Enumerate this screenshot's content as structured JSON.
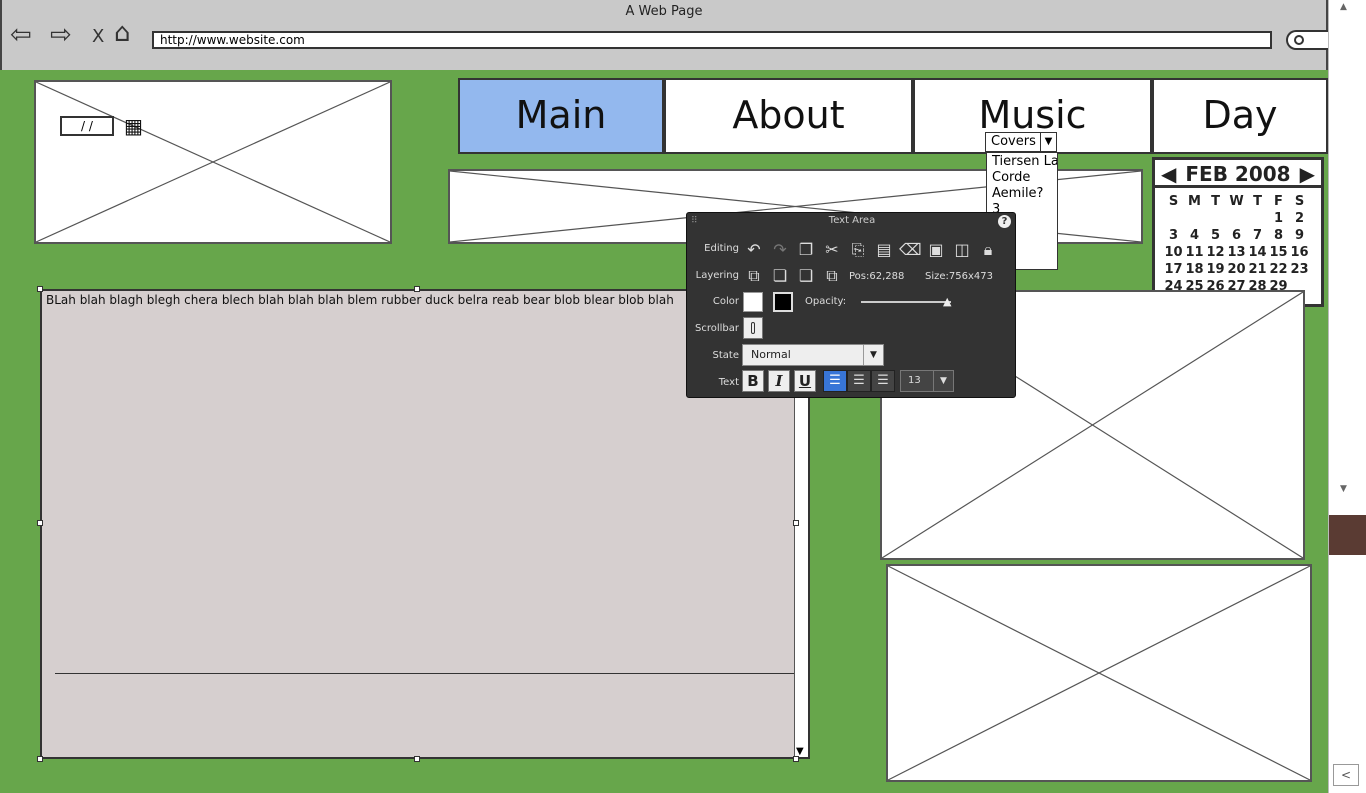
{
  "browser": {
    "title": "A Web Page",
    "url": "http://www.website.com",
    "close_glyph": "X",
    "icons": [
      "back-arrow-icon",
      "forward-arrow-icon",
      "stop-icon",
      "home-icon",
      "search-icon"
    ]
  },
  "date_field": {
    "value": "/ /"
  },
  "nav": {
    "tabs": [
      "Main",
      "About",
      "Music",
      "Day"
    ],
    "active": "Main",
    "active_color": "#93b8ee"
  },
  "music_dropdown": {
    "selected": "Covers",
    "items": [
      "Tiersen La",
      "Corde",
      "Aemile?",
      "3"
    ]
  },
  "calendar": {
    "month": "FEB 2008",
    "weekdays": [
      "S",
      "M",
      "T",
      "W",
      "T",
      "F",
      "S"
    ],
    "weeks": [
      [
        "",
        "",
        "",
        "",
        "",
        "1",
        "2"
      ],
      [
        "3",
        "4",
        "5",
        "6",
        "7",
        "8",
        "9"
      ],
      [
        "10",
        "11",
        "12",
        "13",
        "14",
        "15",
        "16"
      ],
      [
        "17",
        "18",
        "19",
        "20",
        "21",
        "22",
        "23"
      ],
      [
        "24",
        "25",
        "26",
        "27",
        "28",
        "29",
        ""
      ]
    ]
  },
  "text_area": {
    "text": "BLah blah blagh blegh chera blech blah blah blah blem rubber duck belra reab bear blob blear blob blah"
  },
  "properties_panel": {
    "title": "Text Area",
    "help": "?",
    "labels": {
      "editing": "Editing",
      "layering": "Layering",
      "color": "Color",
      "scrollbar": "Scrollbar",
      "state": "State",
      "text": "Text"
    },
    "pos_label": "Pos:",
    "pos_value": "62,288",
    "size_label": "Size:",
    "size_value": "756x473",
    "opacity_label": "Opacity:",
    "opacity": 1.0,
    "state_value": "Normal",
    "font_size": "13",
    "bold": "B",
    "italic": "I",
    "underline": "U",
    "fill_color": "#ffffff",
    "stroke_color": "#000000"
  },
  "colors": {
    "canvas": "#67a64b",
    "text_area_bg": "#d6cfcf",
    "panel_bg": "#333333"
  }
}
